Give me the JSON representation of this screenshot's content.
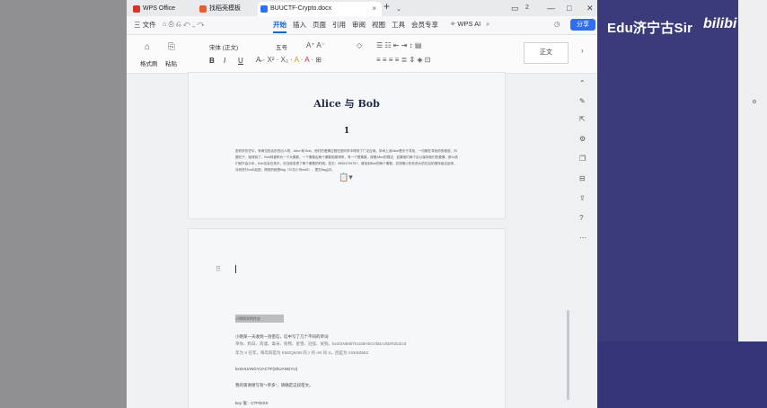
{
  "watermark": {
    "text": "Edu济宁古Sir",
    "logo": "bilibi"
  },
  "tabs": [
    {
      "label": "WPS Office",
      "color": "#d9322b"
    },
    {
      "label": "找稻壳模板",
      "color": "#e85d2b"
    },
    {
      "label": "BUUCTF-Crypto.docx",
      "color": "#2f6ef2"
    }
  ],
  "titlebar_controls": {
    "add": "+",
    "badge": "2",
    "minimize": "—",
    "maximize": "□",
    "close": "✕"
  },
  "menu": {
    "file": "三 文件",
    "items": [
      "开始",
      "插入",
      "页面",
      "引用",
      "审阅",
      "视图",
      "工具",
      "会员专享"
    ],
    "active": "开始",
    "ai": "WPS AI",
    "share": "分享"
  },
  "ribbon": {
    "format_painter": "格式刷",
    "paste": "粘贴",
    "font_name": "宋体 (正文)",
    "font_size": "五号",
    "style": "正文",
    "bold": "B",
    "italic": "I",
    "underline": "U"
  },
  "document": {
    "title": "Alice 与 Bob",
    "number": "1",
    "paragraph": "密码学历史中，有两位知名的杰出人物，Alice 和 Bob。他们的爱情过程在密码学中得到了广泛应用。学术上说Alice是乐于寻找，一切都在寻找你的秘密。问题在于，她得到了。Bob则被称为一个大素数，一个素数由两个素数相乘得来，有一个是素数。按照Alice的想法，如果他们两个足以保持他们的爱情，那么他们就不会分手，Bob也会在其中，但当他发现了两个素数的时候。密文：98554799767，请找到Bob的两个素数，并按照小的在前大的在后的顺序组合起来，对其进行md5加密，得到的就是flag（32位小写md5），提交flag{}中。",
    "highlighted": "小明同学的作业",
    "p2_lines": [
      "小明某一天收到一封密信，信中写了几个不同的单词",
      "  单你、狗日、肉浦、毒米、狗熊、星雪、冠弦、呆狗，kxtZSNtMbTKcDBH5GVbBAJbDRZkZtzd",
      "  年为 X 在年，每年四是为 KMZQkr0B 的 z 的 AR 的 S，因是为 XSKBZMIZ",
      "kxSHUANGYU>CTF{ShUANGYU}",
      "          我的第谢谢写有“+单多”，请确定这段密文。",
      "key 值：CTFDIXX"
    ]
  }
}
